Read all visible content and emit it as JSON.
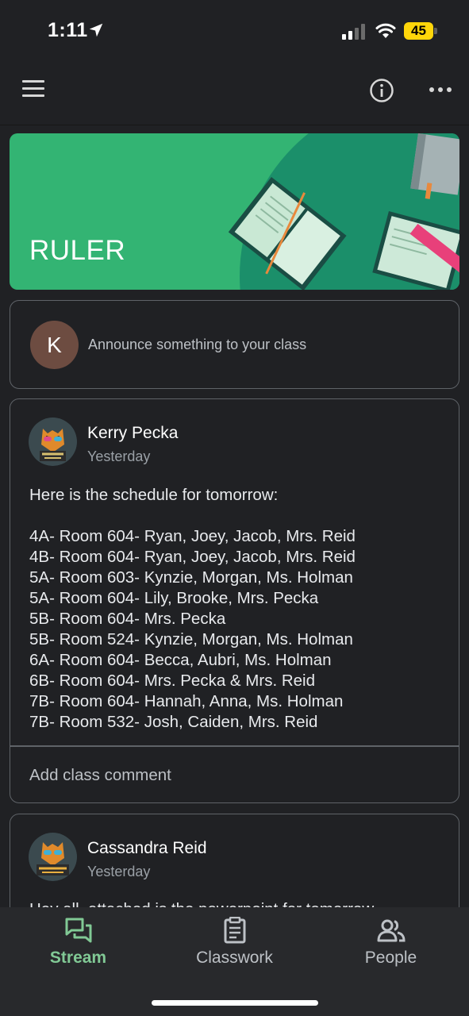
{
  "status_bar": {
    "time": "1:11",
    "battery": "45"
  },
  "app_bar": {
    "icons": [
      "menu-icon",
      "info-icon",
      "more-vert-icon"
    ]
  },
  "banner": {
    "title": "RULER",
    "color": "#33b473"
  },
  "announce": {
    "avatar_initial": "K",
    "placeholder": "Announce something to your class"
  },
  "posts": [
    {
      "author": "Kerry Pecka",
      "time": "Yesterday",
      "intro": "Here is the schedule for tomorrow:",
      "lines": [
        "4A- Room 604- Ryan, Joey, Jacob, Mrs. Reid",
        "4B- Room 604- Ryan, Joey, Jacob, Mrs. Reid",
        "5A- Room 603- Kynzie, Morgan, Ms. Holman",
        "5A- Room 604- Lily, Brooke, Mrs. Pecka",
        "5B- Room 604- Mrs. Pecka",
        "5B- Room 524- Kynzie, Morgan, Ms. Holman",
        "6A- Room 604- Becca, Aubri, Ms. Holman",
        "6B- Room 604- Mrs. Pecka & Mrs. Reid",
        "7B- Room 604- Hannah, Anna, Ms. Holman",
        "7B- Room 532- Josh, Caiden, Mrs. Reid"
      ],
      "comment_placeholder": "Add class comment"
    },
    {
      "author": "Cassandra Reid",
      "time": "Yesterday",
      "intro": "Hey all, attached is the powerpoint for tomorrow"
    }
  ],
  "bottom_nav": {
    "items": [
      {
        "label": "Stream",
        "icon": "stream-icon",
        "active": true
      },
      {
        "label": "Classwork",
        "icon": "classwork-icon",
        "active": false
      },
      {
        "label": "People",
        "icon": "people-icon",
        "active": false
      }
    ],
    "active_color": "#81c995"
  }
}
